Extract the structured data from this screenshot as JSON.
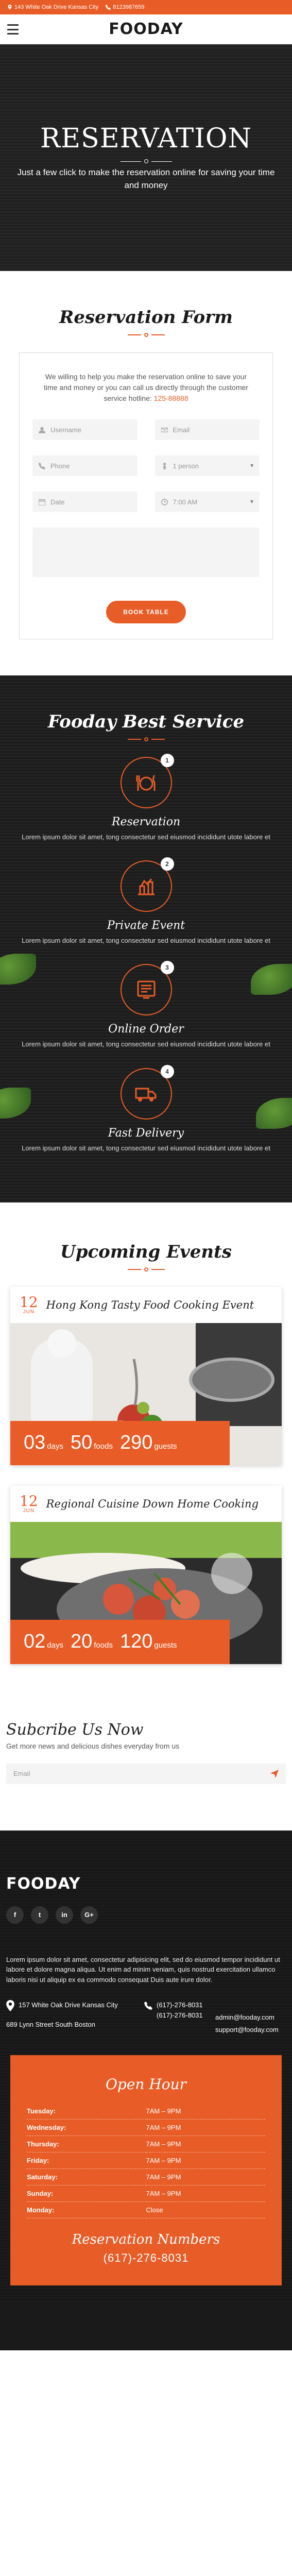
{
  "topbar": {
    "address": "143 White Oak Drive Kansas City",
    "phone": "8123987659"
  },
  "header": {
    "logo": "FOODAY"
  },
  "hero": {
    "title": "RESERVATION",
    "subtitle": "Just a few click to make the reservation online for saving your time and money"
  },
  "reservation": {
    "title": "Reservation Form",
    "intro": "We willing to help you make the reservation online to save your time and money or you can call us directly through the customer service hotline:",
    "hotline": "125-88888",
    "fields": {
      "username": "Username",
      "email": "Email",
      "phone": "Phone",
      "people": "1 person",
      "date": "Date",
      "time": "7:00 AM"
    },
    "button": "BOOK TABLE"
  },
  "services": {
    "title": "Fooday Best Service",
    "items": [
      {
        "num": "1",
        "title": "Reservation",
        "text": "Lorem ipsum dolor sit amet, tong consectetur sed eiusmod incididunt utote labore et",
        "icon": "dish-icon"
      },
      {
        "num": "2",
        "title": "Private Event",
        "text": "Lorem ipsum dolor sit amet, tong consectetur sed eiusmod incididunt utote labore et",
        "icon": "event-icon"
      },
      {
        "num": "3",
        "title": "Online Order",
        "text": "Lorem ipsum dolor sit amet, tong consectetur sed eiusmod incididunt utote labore et",
        "icon": "order-icon"
      },
      {
        "num": "4",
        "title": "Fast Delivery",
        "text": "Lorem ipsum dolor sit amet, tong consectetur sed eiusmod incididunt utote labore et",
        "icon": "truck-icon"
      }
    ]
  },
  "events": {
    "title": "Upcoming Events",
    "items": [
      {
        "day": "12",
        "month": "JUN",
        "title": "Hong Kong Tasty Food Cooking Event",
        "days": "03",
        "days_unit": "days",
        "foods": "50",
        "foods_unit": "foods",
        "guests": "290",
        "guests_unit": "guests"
      },
      {
        "day": "12",
        "month": "JUN",
        "title": "Regional Cuisine Down Home Cooking",
        "days": "02",
        "days_unit": "days",
        "foods": "20",
        "foods_unit": "foods",
        "guests": "120",
        "guests_unit": "guests"
      }
    ]
  },
  "subscribe": {
    "title": "Subcribe Us Now",
    "text": "Get more news and delicious dishes everyday from us",
    "placeholder": "Email"
  },
  "footer": {
    "logo": "FOODAY",
    "socials": [
      "f",
      "t",
      "in",
      "G+"
    ],
    "about": "Lorem ipsum dolor sit amet, consectetur adipisicing elit, sed do eiusmod tempor incididunt ut labore et dolore magna aliqua. Ut enim ad minim veniam, quis nostrud exercitation ullamco laboris nisi ut aliquip ex ea commodo consequat Duis aute irure dolor.",
    "address1": "157 White Oak Drive Kansas City",
    "address2": "689 Lynn Street South Boston",
    "phone1": "(617)-276-8031",
    "phone2": "(617)-276-8031",
    "email1": "admin@fooday.com",
    "email2": "support@fooday.com"
  },
  "hours": {
    "title": "Open Hour",
    "rows": [
      {
        "day": "Tuesday:",
        "time": "7AM – 9PM"
      },
      {
        "day": "Wednesday:",
        "time": "7AM – 9PM"
      },
      {
        "day": "Thursday:",
        "time": "7AM – 9PM"
      },
      {
        "day": "Friday:",
        "time": "7AM – 9PM"
      },
      {
        "day": "Saturday:",
        "time": "7AM – 9PM"
      },
      {
        "day": "Sunday:",
        "time": "7AM – 9PM"
      },
      {
        "day": "Monday:",
        "time": "Close"
      }
    ],
    "res_title": "Reservation Numbers",
    "res_phone": "(617)-276-8031"
  },
  "colors": {
    "accent": "#e85d27",
    "dark": "#222222"
  }
}
